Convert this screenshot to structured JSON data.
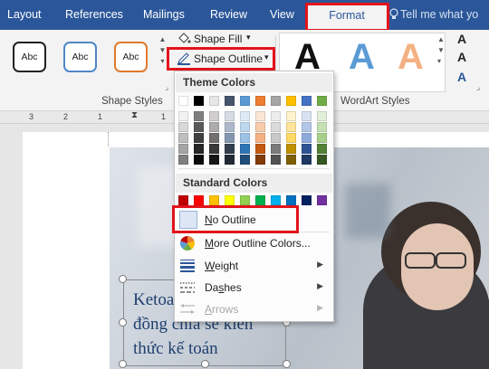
{
  "tabs": [
    "Layout",
    "References",
    "Mailings",
    "Review",
    "View"
  ],
  "active_tab": "Format",
  "tell_me": "Tell me what yo",
  "shape_styles": {
    "sample_text": "Abc",
    "group_label": "Shape Styles",
    "shape_fill_label": "Shape Fill",
    "shape_outline_label": "Shape Outline",
    "colors": [
      "#222222",
      "#4f87c7",
      "#e07a2b"
    ]
  },
  "wordart": {
    "group_label": "WordArt Styles",
    "letter": "A",
    "colors": [
      "#111111",
      "#5b9bd5",
      "#f4b183"
    ]
  },
  "ruler": {
    "numbers": [
      "3",
      "2",
      "1",
      "1"
    ]
  },
  "menu": {
    "theme_colors_label": "Theme Colors",
    "standard_colors_label": "Standard Colors",
    "theme_top_row": [
      "#ffffff",
      "#000000",
      "#e7e6e6",
      "#44546a",
      "#5b9bd5",
      "#ed7d31",
      "#a5a5a5",
      "#ffc000",
      "#4472c4",
      "#70ad47"
    ],
    "theme_shades": [
      [
        "#f2f2f2",
        "#7f7f7f",
        "#d0cece",
        "#d6dce4",
        "#deebf6",
        "#fbe5d5",
        "#ededed",
        "#fff2cc",
        "#d9e2f3",
        "#e2efd9"
      ],
      [
        "#d8d8d8",
        "#595959",
        "#aeabab",
        "#adb9ca",
        "#bdd7ee",
        "#f7cbac",
        "#dbdbdb",
        "#fee599",
        "#b4c6e7",
        "#c5e0b3"
      ],
      [
        "#bfbfbf",
        "#3f3f3f",
        "#757070",
        "#8496b0",
        "#9cc3e5",
        "#f4b183",
        "#c9c9c9",
        "#ffd965",
        "#8eaadb",
        "#a8d08d"
      ],
      [
        "#a5a5a5",
        "#262626",
        "#3a3838",
        "#333f4f",
        "#2e75b5",
        "#c45911",
        "#7b7b7b",
        "#bf9000",
        "#2f5496",
        "#538135"
      ],
      [
        "#7f7f7f",
        "#0c0c0c",
        "#171616",
        "#222a35",
        "#1e4e79",
        "#833c0b",
        "#525252",
        "#7f6000",
        "#1f3864",
        "#375623"
      ]
    ],
    "standard_colors": [
      "#c00000",
      "#ff0000",
      "#ffc000",
      "#ffff00",
      "#92d050",
      "#00b050",
      "#00b0f0",
      "#0070c0",
      "#002060",
      "#7030a0"
    ],
    "no_outline": {
      "hotkey": "N",
      "rest": "o Outline"
    },
    "more_colors": {
      "hotkey": "M",
      "rest": "ore Outline Colors..."
    },
    "weight": {
      "hotkey": "W",
      "rest": "eight"
    },
    "dashes": {
      "pre": "Da",
      "hotkey": "s",
      "post": "hes"
    },
    "arrows": {
      "hotkey": "A",
      "rest": "rrows"
    }
  },
  "textbox": {
    "lines": [
      "Ketoa",
      "đồng chia sẻ kiến",
      "thức kế toán"
    ]
  }
}
